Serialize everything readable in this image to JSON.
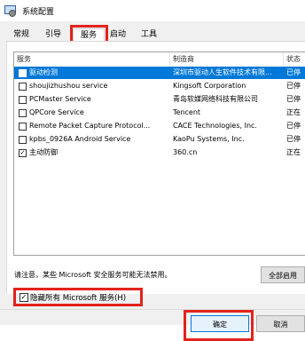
{
  "window": {
    "title": "系统配置"
  },
  "tabs": [
    {
      "label": "常规"
    },
    {
      "label": "引导"
    },
    {
      "label": "服务"
    },
    {
      "label": "启动"
    },
    {
      "label": "工具"
    }
  ],
  "table": {
    "columns": [
      "服务",
      "制造商",
      "状态"
    ],
    "rows": [
      {
        "checked": false,
        "name": "驱动检测",
        "maker": "深圳市驱动人生软件技术有限...",
        "status": "已停",
        "selected": true
      },
      {
        "checked": false,
        "name": "shoujizhushou service",
        "maker": "Kingsoft Corporation",
        "status": "已停",
        "selected": false
      },
      {
        "checked": false,
        "name": "PCMaster Service",
        "maker": "青岛软媒网络科技有限公司",
        "status": "已停",
        "selected": false
      },
      {
        "checked": false,
        "name": "QPCore Service",
        "maker": "Tencent",
        "status": "正在",
        "selected": false
      },
      {
        "checked": false,
        "name": "Remote Packet Capture Protocol...",
        "maker": "CACE Technologies, Inc.",
        "status": "已停",
        "selected": false
      },
      {
        "checked": false,
        "name": "kpbs_0926A Android Service",
        "maker": "KaoPu Systems, Inc.",
        "status": "已停",
        "selected": false
      },
      {
        "checked": true,
        "name": "主动防御",
        "maker": "360.cn",
        "status": "正在",
        "selected": false
      }
    ]
  },
  "note": "请注意，某些 Microsoft 安全服务可能无法禁用。",
  "enable_all_label": "全部启用",
  "hide_ms": {
    "checked": true,
    "label": "隐藏所有 Microsoft 服务(H)",
    "check_glyph": "✓"
  },
  "ok_label": "确定",
  "cancel_label": "取消",
  "colors": {
    "highlight": "#e1231b",
    "selection": "#0078d7"
  }
}
